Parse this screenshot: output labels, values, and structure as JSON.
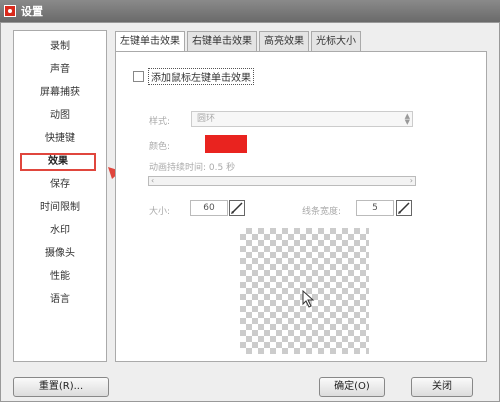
{
  "window": {
    "title": "设置"
  },
  "sidebar": {
    "items": [
      {
        "label": "录制"
      },
      {
        "label": "声音"
      },
      {
        "label": "屏幕捕获"
      },
      {
        "label": "动图"
      },
      {
        "label": "快捷键"
      },
      {
        "label": "效果"
      },
      {
        "label": "保存"
      },
      {
        "label": "时间限制"
      },
      {
        "label": "水印"
      },
      {
        "label": "摄像头"
      },
      {
        "label": "性能"
      },
      {
        "label": "语言"
      }
    ],
    "selected_index": 5
  },
  "tabs": [
    {
      "label": "左键单击效果"
    },
    {
      "label": "右键单击效果"
    },
    {
      "label": "高亮效果"
    },
    {
      "label": "光标大小"
    }
  ],
  "panel": {
    "checkbox_label": "添加鼠标左键单击效果",
    "checked": false,
    "style_label": "样式:",
    "style_value": "圆环",
    "color_label": "颜色:",
    "color_value": "#e9231f",
    "duration_label": "动画持续时间: 0.5 秒",
    "size_label": "大小:",
    "size_value": "60",
    "line_width_label": "线条宽度:",
    "line_width_value": "5"
  },
  "footer": {
    "reset_label": "重置(R)...",
    "ok_label": "确定(O)",
    "cancel_label": "关闭"
  },
  "colors": {
    "highlight": "#e0463d",
    "accent_red": "#e9231f"
  },
  "icons": [
    "record-app-icon",
    "slider-left-arrow-icon",
    "slider-right-arrow-icon",
    "pen-icon",
    "mouse-cursor-icon",
    "red-arrow-icon"
  ]
}
